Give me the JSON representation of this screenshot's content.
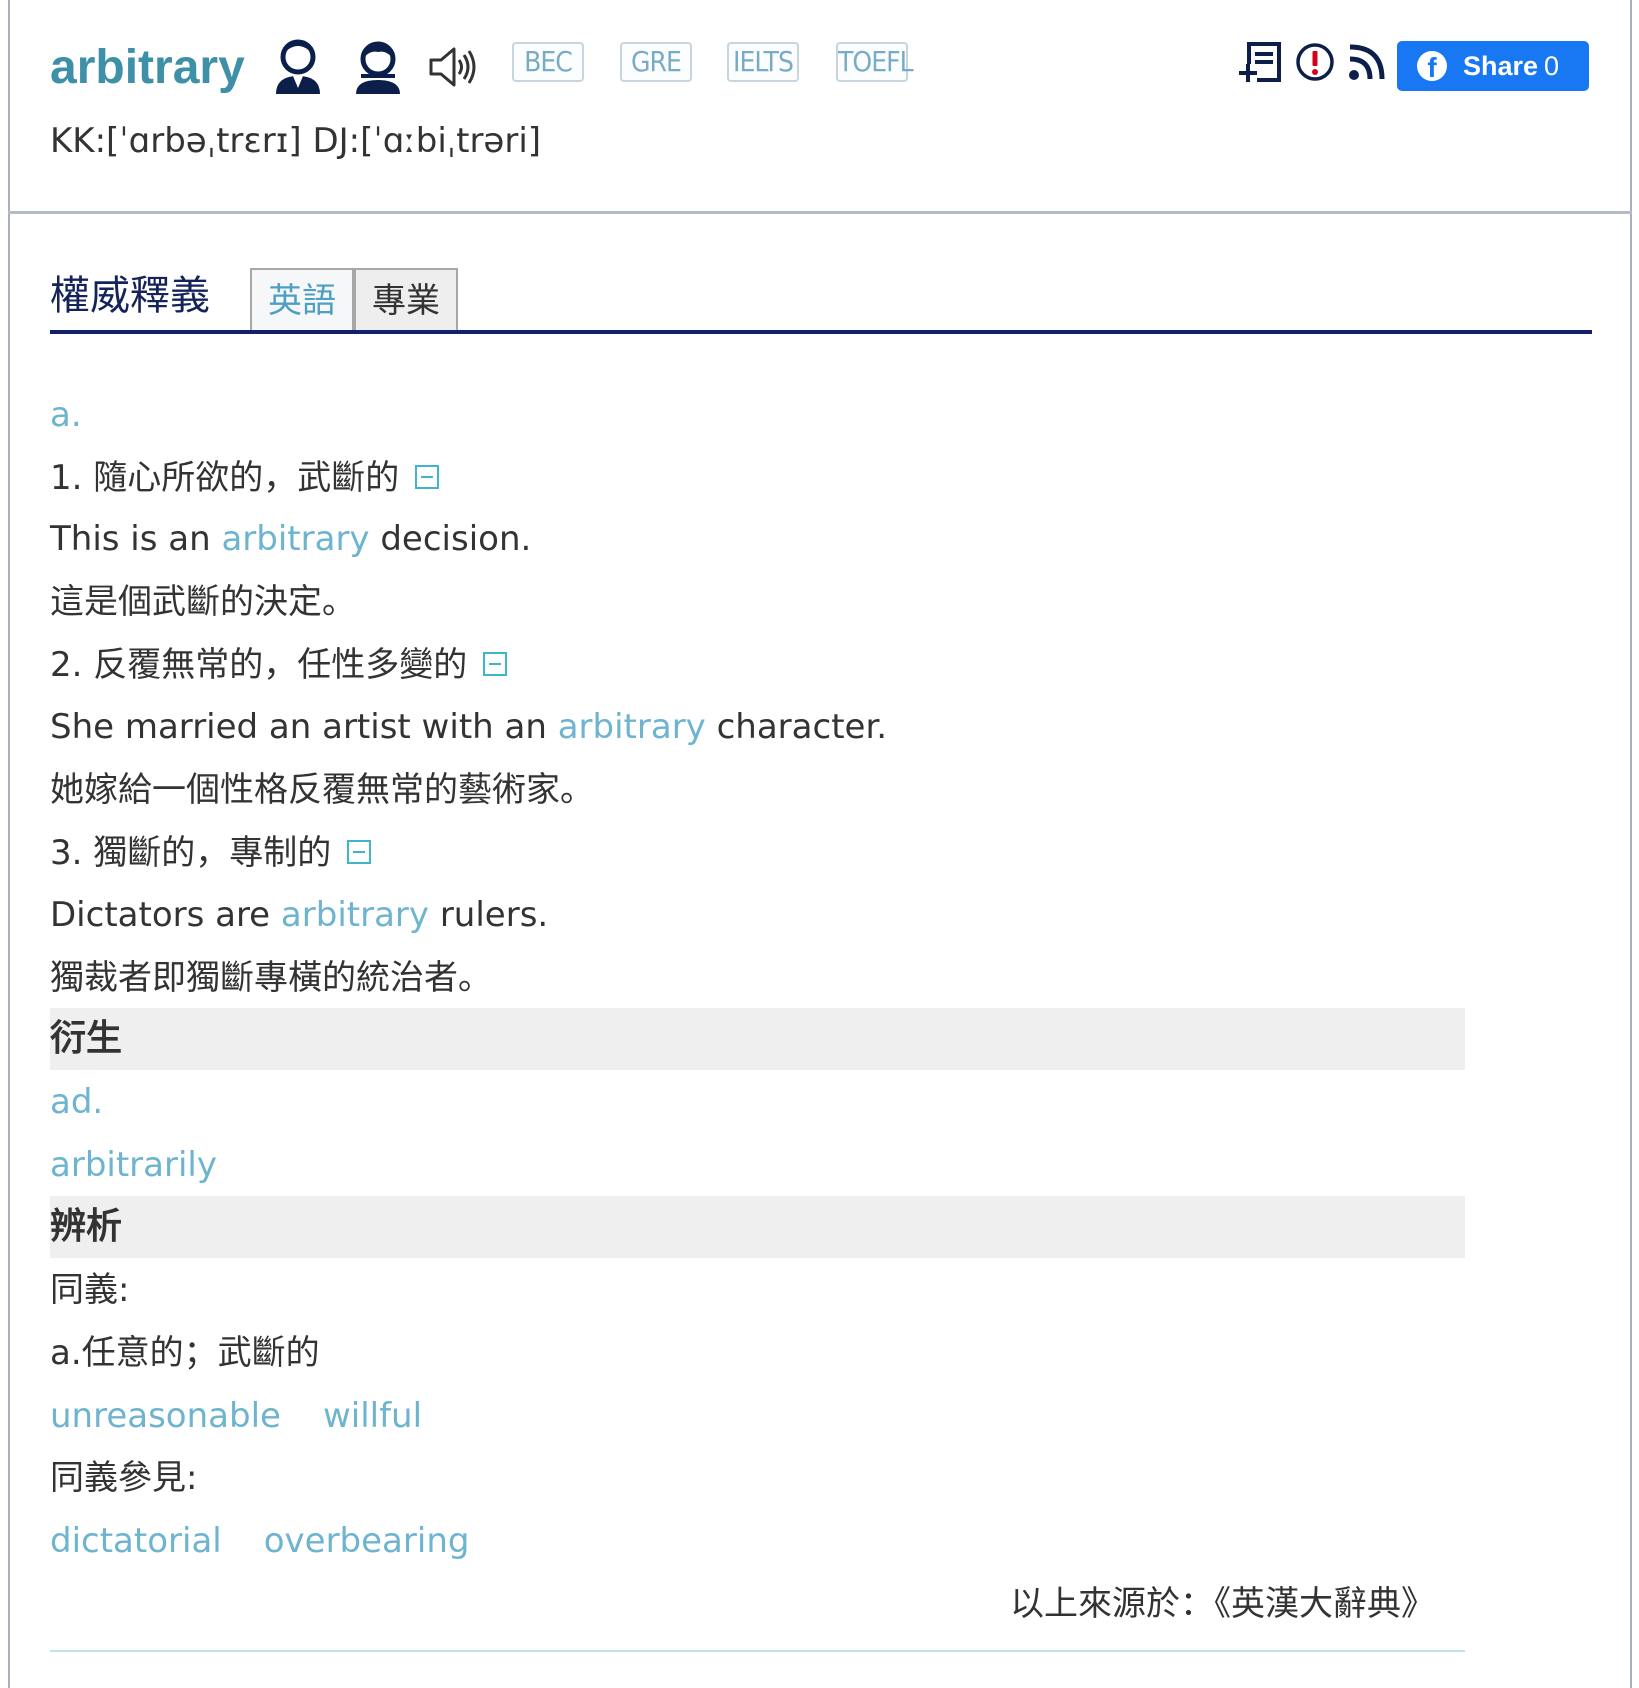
{
  "entry": {
    "word": "arbitrary",
    "phonetic": "KK:[ˈɑrbəˌtrɛrɪ] DJ:[ˈɑːbiˌtrəri]",
    "pronunciation_icons": [
      "male-voice-icon",
      "female-voice-icon",
      "speaker-icon"
    ],
    "exam_tags": [
      "BEC",
      "GRE",
      "IELTS",
      "TOEFL"
    ]
  },
  "toolbar": {
    "icons": [
      "add-to-wordbook-icon",
      "report-error-icon",
      "rss-feed-icon"
    ],
    "share_label": "Share",
    "share_count": "0"
  },
  "section": {
    "title": "權威釋義",
    "tabs": [
      "英語",
      "專業"
    ],
    "active_tab": "英語"
  },
  "definitions": {
    "pos": "a.",
    "senses": [
      {
        "label": "1. 隨心所欲的，武斷的",
        "example_before": "This is an ",
        "example_word": "arbitrary",
        "example_after": " decision.",
        "translation": "這是個武斷的決定。"
      },
      {
        "label": "2. 反覆無常的，任性多變的",
        "example_before": "She married an artist with an ",
        "example_word": "arbitrary",
        "example_after": " character.",
        "translation": "她嫁給一個性格反覆無常的藝術家。"
      },
      {
        "label": "3. 獨斷的，專制的",
        "example_before": "Dictators are ",
        "example_word": "arbitrary",
        "example_after": " rulers.",
        "translation": "獨裁者即獨斷專橫的統治者。"
      }
    ]
  },
  "derivatives": {
    "heading": "衍生",
    "pos": "ad.",
    "word": "arbitrarily"
  },
  "analysis": {
    "heading": "辨析",
    "synonyms_label": "同義:",
    "synonyms_sense": "a.任意的；武斷的",
    "synonyms": [
      "unreasonable",
      "willful"
    ],
    "see_also_label": "同義參見:",
    "see_also": [
      "dictatorial",
      "overbearing"
    ]
  },
  "source": "以上來源於：《英漢大辭典》",
  "colors": {
    "word": "#3e8fa8",
    "link": "#6eb4cf",
    "section_title": "#14245a",
    "section_rule": "#13206a",
    "facebook": "#1877f2"
  }
}
